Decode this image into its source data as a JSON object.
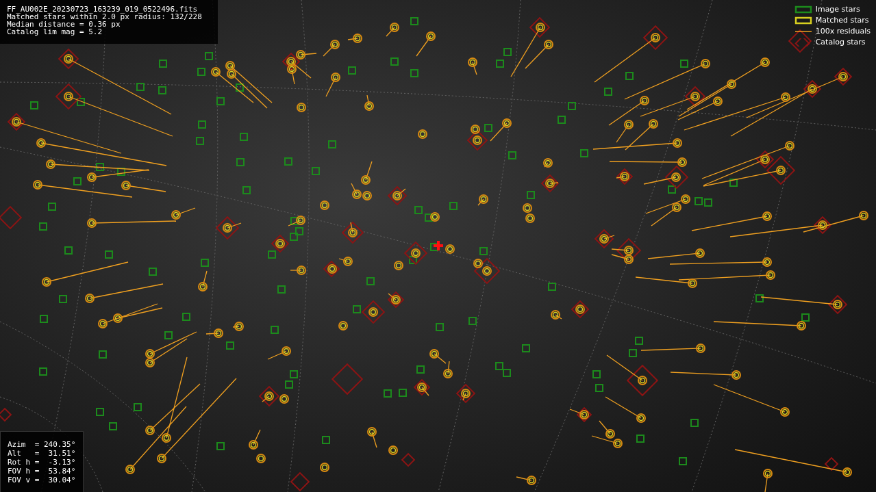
{
  "info": {
    "lines": [
      "FF_AU002E_20230723_163239_019_0522496.fits",
      "Matched stars within 2.0 px radius: 132/228",
      "Median distance = 0.36 px",
      "Catalog lim mag = 5.2"
    ]
  },
  "legend": [
    {
      "kind": "image",
      "label": "Image stars"
    },
    {
      "kind": "matched",
      "label": "Matched stars"
    },
    {
      "kind": "residual",
      "label": "100x residuals"
    },
    {
      "kind": "catalog",
      "label": "Catalog stars"
    }
  ],
  "pointing": {
    "lines": [
      "Azim  = 240.35°",
      "Alt   =  31.51°",
      "Rot h =  -3.13°",
      "FOV h =  53.84°",
      "FOV v =  30.04°"
    ]
  }
}
